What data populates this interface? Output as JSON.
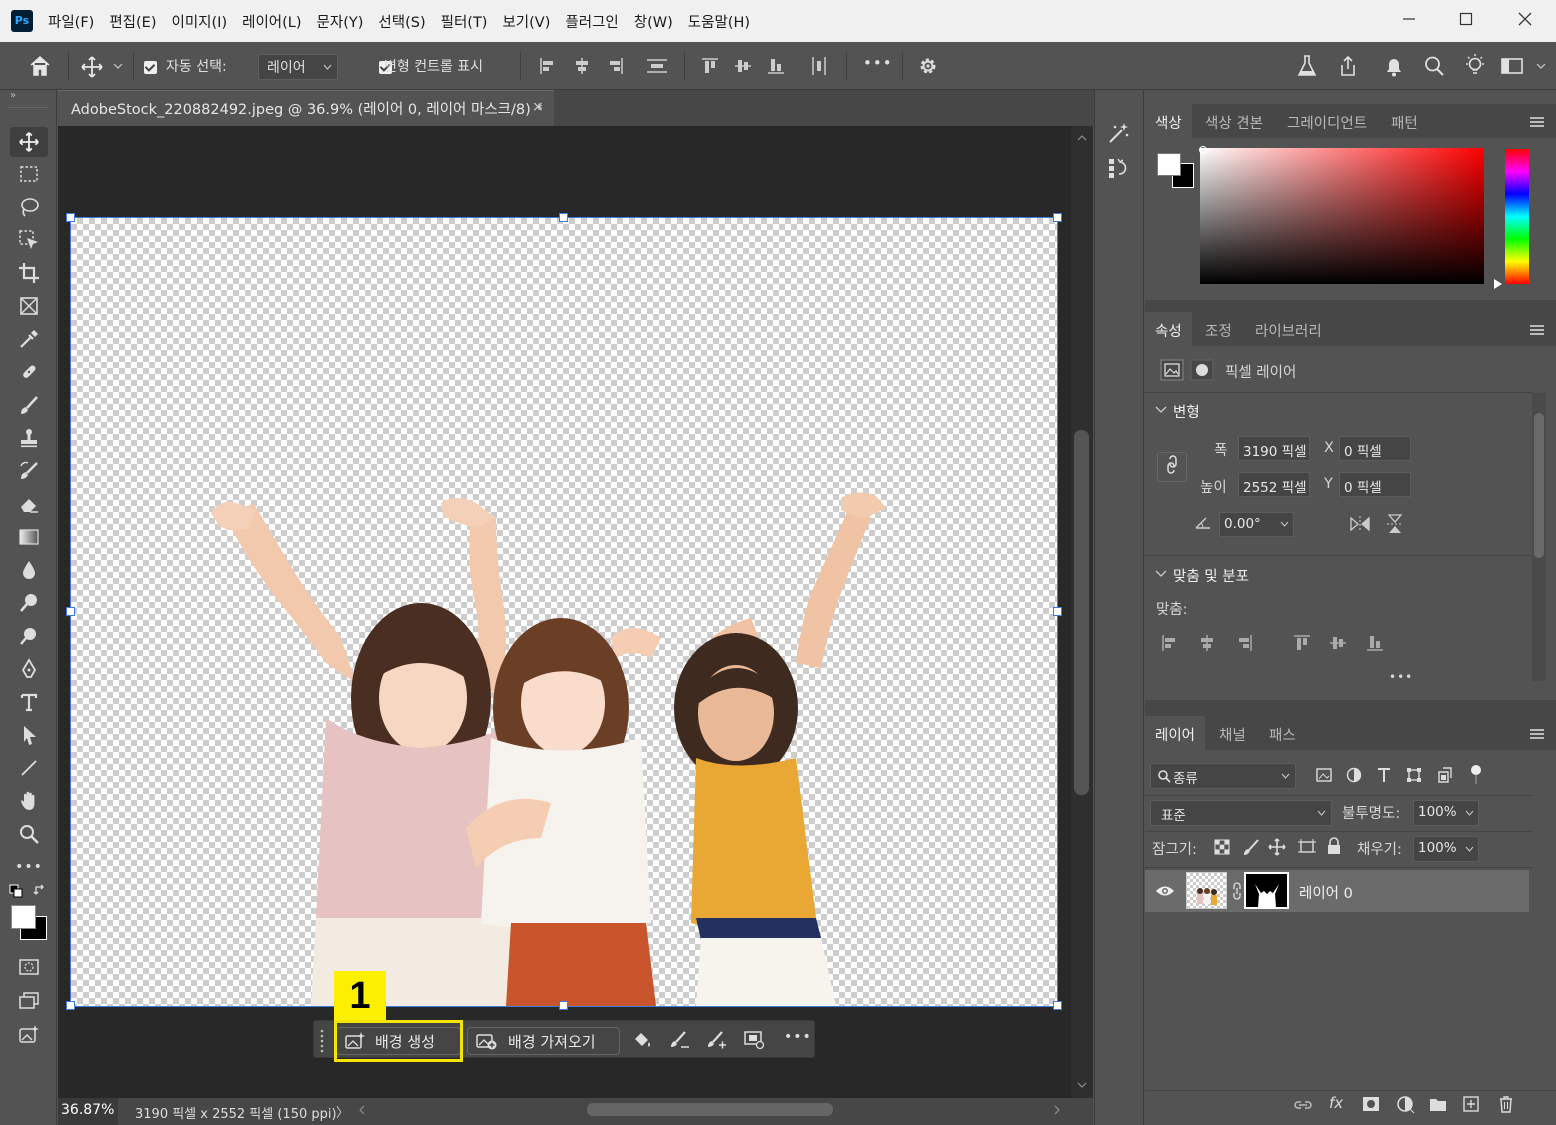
{
  "app": {
    "logo": "Ps",
    "menu": [
      "파일(F)",
      "편집(E)",
      "이미지(I)",
      "레이어(L)",
      "문자(Y)",
      "선택(S)",
      "필터(T)",
      "보기(V)",
      "플러그인",
      "창(W)",
      "도움말(H)"
    ]
  },
  "options_bar": {
    "auto_select_label": "자동 선택:",
    "auto_select_value": "레이어",
    "show_transform_label": "변형 컨트롤 표시",
    "more": "•••"
  },
  "document": {
    "tab_title": "AdobeStock_220882492.jpeg @ 36.9% (레이어 0, 레이어 마스크/8) *",
    "close": "×",
    "zoom": "36.87%",
    "dimensions": "3190 픽셀 x 2552 픽셀 (150 ppi)",
    "status_arrow": "〉"
  },
  "taskbar": {
    "generate_background": "배경 생성",
    "import_background": "배경 가져오기",
    "more": "•••"
  },
  "annotation": {
    "step": "1",
    "color": "#fbf000"
  },
  "color_panel": {
    "tabs": [
      "색상",
      "색상 견본",
      "그레이디언트",
      "패턴"
    ],
    "hue": "#ff0000"
  },
  "properties_panel": {
    "tabs": [
      "속성",
      "조정",
      "라이브러리"
    ],
    "layer_type": "픽셀 레이어",
    "transform_section": "변형",
    "width_label": "폭",
    "width_value": "3190 픽셀",
    "height_label": "높이",
    "height_value": "2552 픽셀",
    "x_label": "X",
    "x_value": "0 픽셀",
    "y_label": "Y",
    "y_value": "0 픽셀",
    "angle_value": "0.00°",
    "align_section": "맞춤 및 분포",
    "align_label": "맞춤:",
    "more": "•••"
  },
  "layers_panel": {
    "tabs": [
      "레이어",
      "채널",
      "패스"
    ],
    "filter_label": "종류",
    "blend_mode": "표준",
    "opacity_label": "불투명도:",
    "opacity_value": "100%",
    "lock_label": "잠그기:",
    "fill_label": "채우기:",
    "fill_value": "100%",
    "layer_name": "레이어 0",
    "fx_label": "fx"
  }
}
